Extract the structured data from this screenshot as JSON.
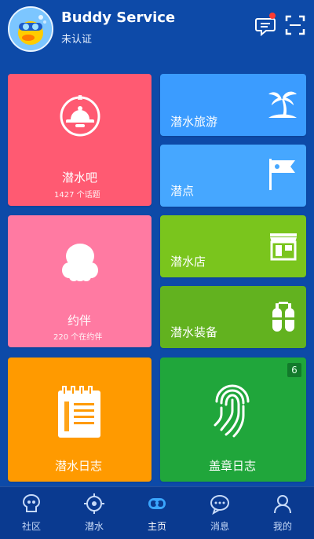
{
  "header": {
    "user_name": "Buddy Service",
    "user_status": "未认证",
    "avatar_icon": "diver-duck-avatar",
    "message_icon": "message-icon",
    "scan_icon": "scan-icon",
    "notification_dot_color": "#ff3b30"
  },
  "tiles": {
    "club": {
      "label": "潜水吧",
      "sub": "1427 个话题",
      "icon": "dive-helmet-icon",
      "color": "#ff5a72"
    },
    "buddy": {
      "label": "约伴",
      "sub": "220 个在约伴",
      "icon": "octopus-icon",
      "color": "#ff7aa2"
    },
    "log": {
      "label": "潜水日志",
      "icon": "dive-log-book-icon",
      "color": "#ff9a00"
    },
    "travel": {
      "label": "潜水旅游",
      "icon": "palm-island-icon",
      "color": "#3b9cff"
    },
    "spot": {
      "label": "潜点",
      "icon": "flag-icon",
      "color": "#46a7ff"
    },
    "shop": {
      "label": "潜水店",
      "icon": "storefront-icon",
      "color": "#7ac51d"
    },
    "equip": {
      "label": "潜水装备",
      "icon": "tanks-icon",
      "color": "#62b21f"
    },
    "stamp": {
      "label": "盖章日志",
      "badge": "6",
      "icon": "fingerprint-icon",
      "color": "#20a63b"
    }
  },
  "tabbar": {
    "items": [
      {
        "label": "社区",
        "icon": "community-icon"
      },
      {
        "label": "潜水",
        "icon": "dive-icon"
      },
      {
        "label": "主页",
        "icon": "home-mask-icon",
        "active": true
      },
      {
        "label": "消息",
        "icon": "messages-icon"
      },
      {
        "label": "我的",
        "icon": "profile-icon"
      }
    ]
  }
}
